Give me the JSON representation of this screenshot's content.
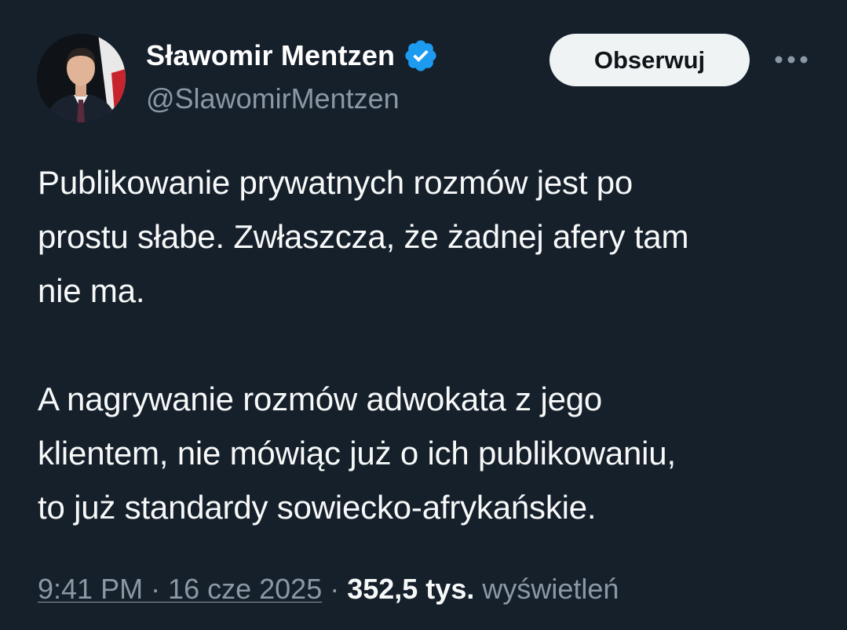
{
  "author": {
    "display_name": "Sławomir Mentzen",
    "handle": "@SlawomirMentzen",
    "verified": true
  },
  "actions": {
    "follow_label": "Obserwuj",
    "more_icon": "ellipsis-icon"
  },
  "tweet": {
    "text": "Publikowanie prywatnych rozmów jest po\nprostu słabe. Zwłaszcza, że żadnej afery tam\nnie ma.\n\nA nagrywanie rozmów adwokata z jego\nklientem, nie mówiąc już o ich publikowaniu,\nto już standardy sowiecko-afrykańskie."
  },
  "meta": {
    "time": "9:41 PM",
    "date": "16 cze 2025",
    "time_date": "9:41 PM · 16 cze 2025",
    "separator": "·",
    "views_count": "352,5 tys.",
    "views_label": "wyświetleń"
  },
  "colors": {
    "background": "#16202b",
    "verified_badge": "#1d9bf0",
    "follow_button_bg": "#eff3f4",
    "secondary_text": "#8b98a5"
  }
}
